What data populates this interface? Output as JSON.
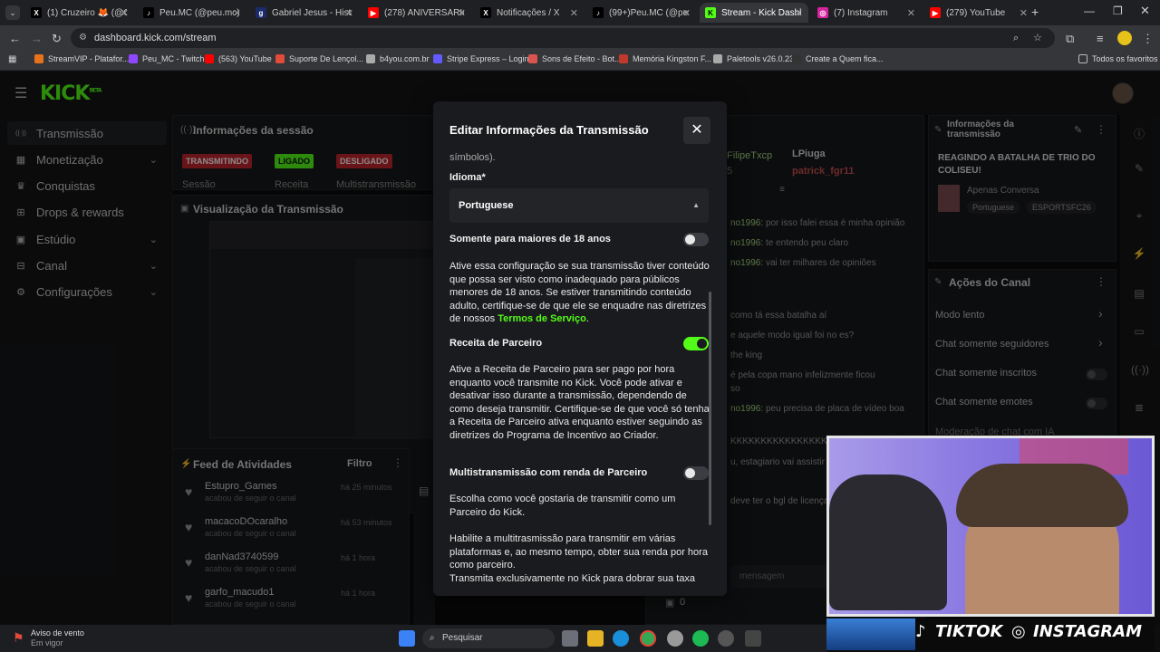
{
  "browser": {
    "tabs": [
      {
        "title": "(1) Cruzeiro 🦊 (@Cruz",
        "icon": "x-icon"
      },
      {
        "title": "Peu.MC (@peu.mc) | T",
        "icon": "tiktok-icon"
      },
      {
        "title": "Gabriel Jesus - Históri",
        "icon": "site-icon"
      },
      {
        "title": "(278) ANIVERSÁRIO D",
        "icon": "youtube-icon"
      },
      {
        "title": "Notificações / X",
        "icon": "x-icon"
      },
      {
        "title": "(99+)Peu.MC (@peu.m",
        "icon": "tiktok-icon"
      },
      {
        "title": "Stream - Kick Dashbo",
        "icon": "kick-icon"
      },
      {
        "title": "(7) Instagram",
        "icon": "instagram-icon"
      },
      {
        "title": "(279) YouTube",
        "icon": "youtube-icon"
      }
    ],
    "new_tab": "+",
    "url": "dashboard.kick.com/stream",
    "bookmarks": [
      "StreamVIP - Platafor...",
      "Peu_MC - Twitch",
      "(563) YouTube",
      "Suporte De Lençol...",
      "b4you.com.br",
      "Stripe Express – Login",
      "Sons de Efeito - Bot...",
      "Memória Kingston F...",
      "Paletools v26.0.23",
      "Create a Quem fica..."
    ],
    "all_favorites": "Todos os favoritos"
  },
  "kick": {
    "logo": "KICK",
    "logo_sup": "BETA",
    "sidebar": [
      {
        "label": "Transmissão",
        "icon": "broadcast-icon",
        "chevron": false
      },
      {
        "label": "Monetização",
        "icon": "money-icon",
        "chevron": true
      },
      {
        "label": "Conquistas",
        "icon": "trophy-icon",
        "chevron": false
      },
      {
        "label": "Drops & rewards",
        "icon": "gift-icon",
        "chevron": false
      },
      {
        "label": "Estúdio",
        "icon": "studio-icon",
        "chevron": true
      },
      {
        "label": "Canal",
        "icon": "channel-icon",
        "chevron": true
      },
      {
        "label": "Configurações",
        "icon": "gear-icon",
        "chevron": true
      }
    ],
    "session": {
      "header": "Informações da sessão",
      "badges": [
        "TRANSMITINDO",
        "LIGADO",
        "DESLIGADO"
      ],
      "labels": [
        "Sessão",
        "Receita",
        "Multistransmissão"
      ]
    },
    "preview_header": "Visualização da Transmissão",
    "feed": {
      "header": "Feed de Atividades",
      "filter": "Filtro",
      "items": [
        {
          "name": "Estupro_Games",
          "sub": "acabou de seguir o canal",
          "time": "há 25 minutos"
        },
        {
          "name": "macacoDOcaralho",
          "sub": "acabou de seguir o canal",
          "time": "há 53 minutos"
        },
        {
          "name": "danNad3740599",
          "sub": "acabou de seguir o canal",
          "time": "há 1 hora"
        },
        {
          "name": "garfo_macudo1",
          "sub": "acabou de seguir o canal",
          "time": "há 1 hora"
        }
      ]
    },
    "chat": {
      "users": [
        "FilipeTxcp",
        "LPiuga",
        "patrick_fgr11"
      ],
      "counter": "5",
      "lines": [
        {
          "user": "no1996:",
          "msg": "por isso falei essa é minha opinião"
        },
        {
          "user": "no1996:",
          "msg": "te entendo peu claro"
        },
        {
          "user": "no1996:",
          "msg": "vai ter milhares de opiniões"
        },
        {
          "user": "",
          "msg": "como tá essa batalha aí"
        },
        {
          "user": "",
          "msg": "e aquele modo igual foi no es?"
        },
        {
          "user": "",
          "msg": "the king"
        },
        {
          "user": "",
          "msg": "é pela copa mano infelizmente ficou"
        },
        {
          "user": "",
          "msg": "so"
        },
        {
          "user": "no1996:",
          "msg": "peu precisa de placa de vídeo boa"
        },
        {
          "user": "",
          "msg": "KKKKKKKKKKKKKKKKKKKK"
        },
        {
          "user": "",
          "msg": "u, estagiario vai assistir"
        },
        {
          "user": "",
          "msg": "deve ter o bgl de licença"
        }
      ],
      "input_placeholder": "mensagem",
      "viewer_count": "0"
    },
    "stream_info": {
      "header": "Informações da transmissão",
      "title": "REAGINDO A BATALHA DE TRIO DO COLISEU!",
      "category": "Apenas Conversa",
      "tags": [
        "Portuguese",
        "ESPORTSFC26"
      ]
    },
    "channel_actions": {
      "header": "Ações do Canal",
      "items": [
        "Modo lento",
        "Chat somente seguidores",
        "Chat somente inscritos",
        "Chat somente emotes"
      ],
      "partial": "Moderação de chat com IA"
    }
  },
  "modal": {
    "title": "Editar Informações da Transmissão",
    "cut_text": "símbolos).",
    "language_label": "Idioma*",
    "language_value": "Portuguese",
    "adult_label": "Somente para maiores de 18 anos",
    "adult_desc": "Ative essa configuração se sua transmissão tiver conteúdo que possa ser visto como inadequado para públicos menores de 18 anos. Se estiver transmitindo conteúdo adulto, certifique-se de que ele se enquadre nas diretrizes de nossos ",
    "adult_link": "Termos de Serviço",
    "adult_end": ".",
    "partner_label": "Receita de Parceiro",
    "partner_desc": "Ative a Receita de Parceiro para ser pago por hora enquanto você transmite no Kick. Você pode ativar e desativar isso durante a transmissão, dependendo de como deseja transmitir. Certifique-se de que você só tenha a Receita de Parceiro ativa enquanto estiver seguindo as diretrizes do Programa de Incentivo ao Criador.",
    "multi_label": "Multistransmissão com renda de Parceiro",
    "multi_desc1": "Escolha como você gostaria de transmitir como um Parceiro do Kick.",
    "multi_desc2": "Habilite a multitrasmissão para transmitir em várias plataformas e, ao mesmo tempo, obter sua renda por hora como parceiro.",
    "multi_desc3": "Transmita exclusivamente no Kick para dobrar sua taxa",
    "toggles": {
      "adult": false,
      "partner": true,
      "multi": false
    }
  },
  "overlay": {
    "tiktok": "TIKTOK",
    "instagram": "INSTAGRAM"
  },
  "taskbar": {
    "weather_title": "Aviso de vento",
    "weather_sub": "Em vigor",
    "search": "Pesquisar"
  },
  "colors": {
    "kick_green": "#53fc18",
    "badge_red": "#c0262d",
    "badge_green": "#53fc18"
  }
}
